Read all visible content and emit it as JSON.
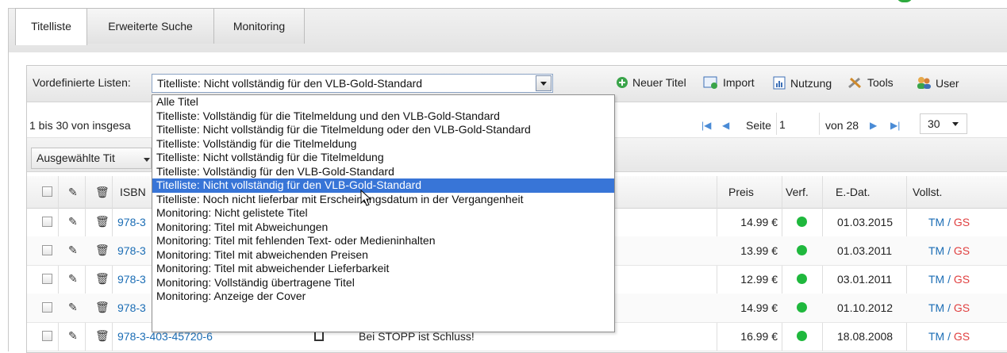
{
  "tabs": [
    "Titelliste",
    "Erweiterte Suche",
    "Monitoring"
  ],
  "toolbar": {
    "predefined_label": "Vordefinierte Listen:",
    "selected_list": "Titelliste: Nicht vollständig für den VLB-Gold-Standard",
    "buttons": [
      {
        "label": "Neuer Titel",
        "icon": "plus-circle-icon"
      },
      {
        "label": "Import",
        "icon": "import-icon"
      },
      {
        "label": "Nutzung",
        "icon": "chart-icon"
      },
      {
        "label": "Tools",
        "icon": "tools-icon"
      },
      {
        "label": "User",
        "icon": "users-icon"
      }
    ]
  },
  "paging": {
    "info": "1 bis 30 von insgesa",
    "page_label": "Seite",
    "page_value": "1",
    "of_label": "von 28",
    "page_size": "30"
  },
  "selection_dropdown": "Ausgewählte Tit",
  "columns": {
    "isbn": "ISBN",
    "preis": "Preis",
    "verf": "Verf.",
    "edat": "E.-Dat.",
    "vollst": "Vollst."
  },
  "rows": [
    {
      "isbn": "978-3",
      "title": "",
      "preis": "14.99 €",
      "edat": "01.03.2015",
      "tm": "TM",
      "gs": "GS"
    },
    {
      "isbn": "978-3",
      "title": "",
      "preis": "13.99 €",
      "edat": "01.03.2011",
      "tm": "TM",
      "gs": "GS"
    },
    {
      "isbn": "978-3",
      "title": "",
      "preis": "12.99 €",
      "edat": "03.01.2011",
      "tm": "TM",
      "gs": "GS"
    },
    {
      "isbn": "978-3",
      "title": "",
      "preis": "14.99 €",
      "edat": "01.10.2012",
      "tm": "TM",
      "gs": "GS"
    },
    {
      "isbn": "978-3-403-45720-6",
      "title": "Bei STOPP ist Schluss!",
      "preis": "16.99 €",
      "edat": "18.08.2008",
      "tm": "TM",
      "gs": "GS"
    }
  ],
  "dropdown_options": [
    "Alle Titel",
    "Titelliste: Vollständig für die Titelmeldung und den VLB-Gold-Standard",
    "Titelliste: Nicht vollständig für die Titelmeldung oder den VLB-Gold-Standard",
    "Titelliste: Vollständig für die Titelmeldung",
    "Titelliste: Nicht vollständig für die Titelmeldung",
    "Titelliste: Vollständig für den VLB-Gold-Standard",
    "Titelliste: Nicht vollständig für den VLB-Gold-Standard",
    "Titelliste: Noch nicht lieferbar mit Erscheinungsdatum in der Vergangenheit",
    "Monitoring: Nicht gelistete Titel",
    "Monitoring: Titel mit Abweichungen",
    "Monitoring: Titel mit fehlenden Text- oder Medieninhalten",
    "Monitoring: Titel mit abweichenden Preisen",
    "Monitoring: Titel mit abweichender Lieferbarkeit",
    "Monitoring: Vollständig übertragene Titel",
    "Monitoring: Anzeige der Cover"
  ],
  "dropdown_selected_index": 6,
  "colors": {
    "accent": "#3875d7",
    "link": "#1b6db5",
    "status_green": "#1fb83d",
    "gs_red": "#e04040"
  }
}
